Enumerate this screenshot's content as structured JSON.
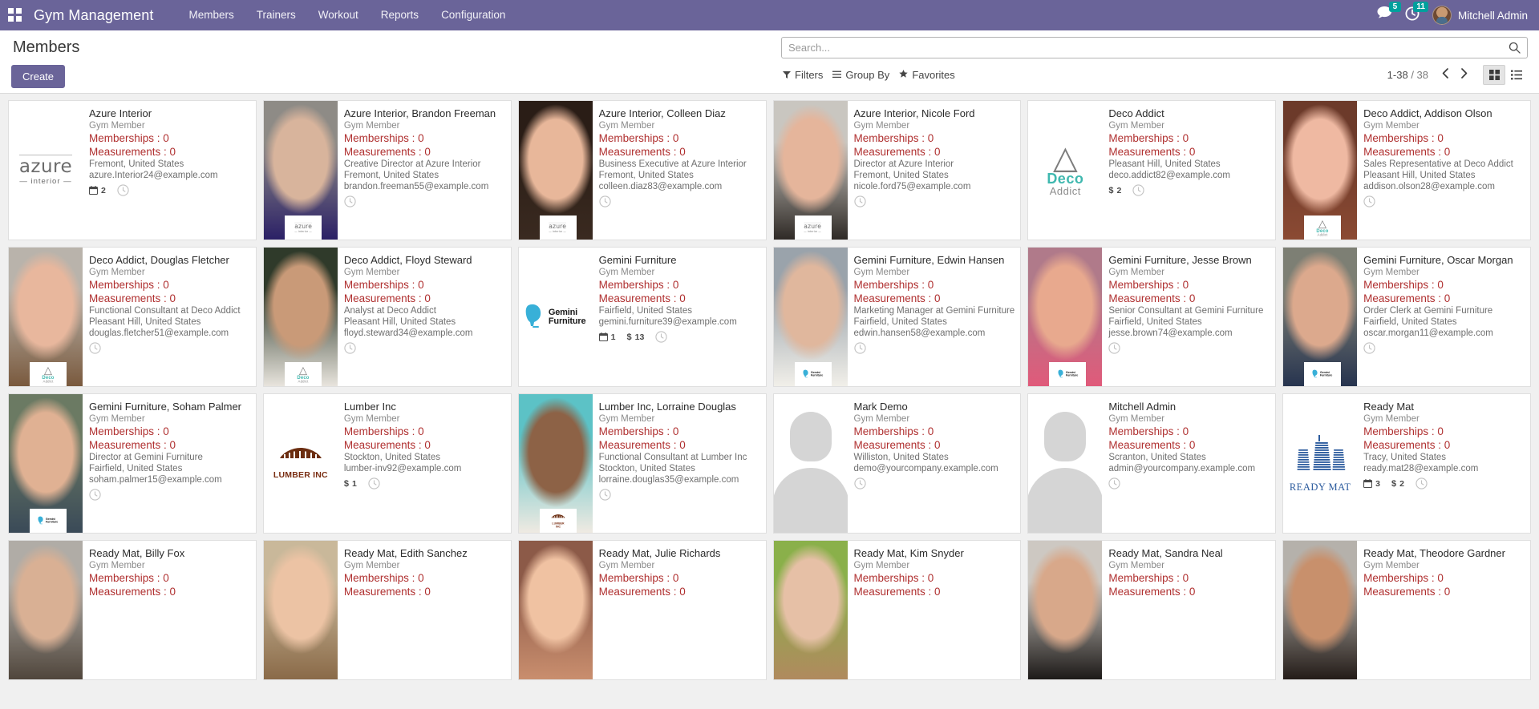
{
  "navbar": {
    "apps_icon": "apps-grid-icon",
    "brand": "Gym Management",
    "menu": [
      {
        "label": "Members"
      },
      {
        "label": "Trainers"
      },
      {
        "label": "Workout"
      },
      {
        "label": "Reports"
      },
      {
        "label": "Configuration"
      }
    ],
    "messages_icon": "chat-bubble-icon",
    "messages_count": "5",
    "activities_icon": "clock-icon",
    "activities_count": "11",
    "user_avatar_icon": "user-avatar",
    "user_name": "Mitchell Admin",
    "bg_color": "#6a6499",
    "badge_color": "#00a09d"
  },
  "control_panel": {
    "page_title": "Members",
    "create_label": "Create",
    "search_placeholder": "Search...",
    "search_value": "",
    "search_icon": "search-icon",
    "filters_label": "Filters",
    "filters_icon": "filter-icon",
    "groupby_label": "Group By",
    "groupby_icon": "list-icon",
    "favorites_label": "Favorites",
    "favorites_icon": "star-icon",
    "pager_range": "1-38",
    "pager_total": "/ 38",
    "prev_icon": "chevron-left-icon",
    "next_icon": "chevron-right-icon",
    "kanban_view_icon": "kanban-view-icon",
    "list_view_icon": "list-view-icon",
    "active_view": "kanban"
  },
  "labels": {
    "role": "Gym Member",
    "memberships": "Memberships : 0",
    "measurements": "Measurements : 0",
    "stat_color": "#b03030"
  },
  "cards": [
    {
      "name": "Azure Interior",
      "role": "Gym Member",
      "memberships": "Memberships : 0",
      "measurements": "Measurements : 0",
      "job": "",
      "location": "Fremont, United States",
      "email": "azure.Interior24@example.com",
      "media": "logo-azure",
      "logo_tag": "",
      "badges": [
        {
          "icon": "calendar-icon",
          "value": "2"
        }
      ],
      "clock": true
    },
    {
      "name": "Azure Interior, Brandon Freeman",
      "role": "Gym Member",
      "memberships": "Memberships : 0",
      "measurements": "Measurements : 0",
      "job": "Creative Director at Azure Interior",
      "location": "Fremont, United States",
      "email": "brandon.freeman55@example.com",
      "media": "photo",
      "photo": "m1",
      "logo_tag": "logo-azure",
      "badges": [],
      "clock": true
    },
    {
      "name": "Azure Interior, Colleen Diaz",
      "role": "Gym Member",
      "memberships": "Memberships : 0",
      "measurements": "Measurements : 0",
      "job": "Business Executive at Azure Interior",
      "location": "Fremont, United States",
      "email": "colleen.diaz83@example.com",
      "media": "photo",
      "photo": "f1",
      "logo_tag": "logo-azure",
      "badges": [],
      "clock": true
    },
    {
      "name": "Azure Interior, Nicole Ford",
      "role": "Gym Member",
      "memberships": "Memberships : 0",
      "measurements": "Measurements : 0",
      "job": "Director at Azure Interior",
      "location": "Fremont, United States",
      "email": "nicole.ford75@example.com",
      "media": "photo",
      "photo": "f2",
      "logo_tag": "logo-azure",
      "badges": [],
      "clock": true
    },
    {
      "name": "Deco Addict",
      "role": "Gym Member",
      "memberships": "Memberships : 0",
      "measurements": "Measurements : 0",
      "job": "",
      "location": "Pleasant Hill, United States",
      "email": "deco.addict82@example.com",
      "media": "logo-deco",
      "logo_tag": "",
      "badges": [
        {
          "icon": "dollar-icon",
          "value": "2"
        }
      ],
      "clock": true
    },
    {
      "name": "Deco Addict, Addison Olson",
      "role": "Gym Member",
      "memberships": "Memberships : 0",
      "measurements": "Measurements : 0",
      "job": "Sales Representative at Deco Addict",
      "location": "Pleasant Hill, United States",
      "email": "addison.olson28@example.com",
      "media": "photo",
      "photo": "f3",
      "logo_tag": "logo-deco",
      "badges": [],
      "clock": true
    },
    {
      "name": "Deco Addict, Douglas Fletcher",
      "role": "Gym Member",
      "memberships": "Memberships : 0",
      "measurements": "Measurements : 0",
      "job": "Functional Consultant at Deco Addict",
      "location": "Pleasant Hill, United States",
      "email": "douglas.fletcher51@example.com",
      "media": "photo",
      "photo": "m2",
      "logo_tag": "logo-deco",
      "badges": [],
      "clock": true
    },
    {
      "name": "Deco Addict, Floyd Steward",
      "role": "Gym Member",
      "memberships": "Memberships : 0",
      "measurements": "Measurements : 0",
      "job": "Analyst at Deco Addict",
      "location": "Pleasant Hill, United States",
      "email": "floyd.steward34@example.com",
      "media": "photo",
      "photo": "m3",
      "logo_tag": "logo-deco",
      "badges": [],
      "clock": true
    },
    {
      "name": "Gemini Furniture",
      "role": "Gym Member",
      "memberships": "Memberships : 0",
      "measurements": "Measurements : 0",
      "job": "",
      "location": "Fairfield, United States",
      "email": "gemini.furniture39@example.com",
      "media": "logo-gemini",
      "logo_tag": "",
      "badges": [
        {
          "icon": "calendar-icon",
          "value": "1"
        },
        {
          "icon": "dollar-icon",
          "value": "13"
        }
      ],
      "clock": true
    },
    {
      "name": "Gemini Furniture, Edwin Hansen",
      "role": "Gym Member",
      "memberships": "Memberships : 0",
      "measurements": "Measurements : 0",
      "job": "Marketing Manager at Gemini Furniture",
      "location": "Fairfield, United States",
      "email": "edwin.hansen58@example.com",
      "media": "photo",
      "photo": "m4",
      "logo_tag": "logo-gemini",
      "badges": [],
      "clock": true
    },
    {
      "name": "Gemini Furniture, Jesse Brown",
      "role": "Gym Member",
      "memberships": "Memberships : 0",
      "measurements": "Measurements : 0",
      "job": "Senior Consultant at Gemini Furniture",
      "location": "Fairfield, United States",
      "email": "jesse.brown74@example.com",
      "media": "photo",
      "photo": "m5",
      "logo_tag": "logo-gemini",
      "badges": [],
      "clock": true
    },
    {
      "name": "Gemini Furniture, Oscar Morgan",
      "role": "Gym Member",
      "memberships": "Memberships : 0",
      "measurements": "Measurements : 0",
      "job": "Order Clerk at Gemini Furniture",
      "location": "Fairfield, United States",
      "email": "oscar.morgan11@example.com",
      "media": "photo",
      "photo": "m6",
      "logo_tag": "logo-gemini",
      "badges": [],
      "clock": true
    },
    {
      "name": "Gemini Furniture, Soham Palmer",
      "role": "Gym Member",
      "memberships": "Memberships : 0",
      "measurements": "Measurements : 0",
      "job": "Director at Gemini Furniture",
      "location": "Fairfield, United States",
      "email": "soham.palmer15@example.com",
      "media": "photo",
      "photo": "m7",
      "logo_tag": "logo-gemini",
      "badges": [],
      "clock": true
    },
    {
      "name": "Lumber Inc",
      "role": "Gym Member",
      "memberships": "Memberships : 0",
      "measurements": "Measurements : 0",
      "job": "",
      "location": "Stockton, United States",
      "email": "lumber-inv92@example.com",
      "media": "logo-lumber",
      "logo_tag": "",
      "badges": [
        {
          "icon": "dollar-icon",
          "value": "1"
        }
      ],
      "clock": true
    },
    {
      "name": "Lumber Inc, Lorraine Douglas",
      "role": "Gym Member",
      "memberships": "Memberships : 0",
      "measurements": "Measurements : 0",
      "job": "Functional Consultant at Lumber Inc",
      "location": "Stockton, United States",
      "email": "lorraine.douglas35@example.com",
      "media": "photo",
      "photo": "f4",
      "logo_tag": "logo-lumber",
      "badges": [],
      "clock": true
    },
    {
      "name": "Mark Demo",
      "role": "Gym Member",
      "memberships": "Memberships : 0",
      "measurements": "Measurements : 0",
      "job": "",
      "location": "Williston, United States",
      "email": "demo@yourcompany.example.com",
      "media": "silhouette",
      "logo_tag": "",
      "badges": [],
      "clock": true
    },
    {
      "name": "Mitchell Admin",
      "role": "Gym Member",
      "memberships": "Memberships : 0",
      "measurements": "Measurements : 0",
      "job": "",
      "location": "Scranton, United States",
      "email": "admin@yourcompany.example.com",
      "media": "silhouette",
      "logo_tag": "",
      "badges": [],
      "clock": true
    },
    {
      "name": "Ready Mat",
      "role": "Gym Member",
      "memberships": "Memberships : 0",
      "measurements": "Measurements : 0",
      "job": "",
      "location": "Tracy, United States",
      "email": "ready.mat28@example.com",
      "media": "logo-ready",
      "logo_tag": "",
      "badges": [
        {
          "icon": "calendar-icon",
          "value": "3"
        },
        {
          "icon": "dollar-icon",
          "value": "2"
        }
      ],
      "clock": true
    },
    {
      "name": "Ready Mat, Billy Fox",
      "role": "Gym Member",
      "memberships": "Memberships : 0",
      "measurements": "Measurements : 0",
      "job": "",
      "location": "",
      "email": "",
      "media": "photo",
      "photo": "m8",
      "logo_tag": "",
      "badges": [],
      "clock": false
    },
    {
      "name": "Ready Mat, Edith Sanchez",
      "role": "Gym Member",
      "memberships": "Memberships : 0",
      "measurements": "Measurements : 0",
      "job": "",
      "location": "",
      "email": "",
      "media": "photo",
      "photo": "f5",
      "logo_tag": "",
      "badges": [],
      "clock": false
    },
    {
      "name": "Ready Mat, Julie Richards",
      "role": "Gym Member",
      "memberships": "Memberships : 0",
      "measurements": "Measurements : 0",
      "job": "",
      "location": "",
      "email": "",
      "media": "photo",
      "photo": "f6",
      "logo_tag": "",
      "badges": [],
      "clock": false
    },
    {
      "name": "Ready Mat, Kim Snyder",
      "role": "Gym Member",
      "memberships": "Memberships : 0",
      "measurements": "Measurements : 0",
      "job": "",
      "location": "",
      "email": "",
      "media": "photo",
      "photo": "f7",
      "logo_tag": "",
      "badges": [],
      "clock": false
    },
    {
      "name": "Ready Mat, Sandra Neal",
      "role": "Gym Member",
      "memberships": "Memberships : 0",
      "measurements": "Measurements : 0",
      "job": "",
      "location": "",
      "email": "",
      "media": "photo",
      "photo": "f8",
      "logo_tag": "",
      "badges": [],
      "clock": false
    },
    {
      "name": "Ready Mat, Theodore Gardner",
      "role": "Gym Member",
      "memberships": "Memberships : 0",
      "measurements": "Measurements : 0",
      "job": "",
      "location": "",
      "email": "",
      "media": "photo",
      "photo": "m9",
      "logo_tag": "",
      "badges": [],
      "clock": false
    }
  ]
}
